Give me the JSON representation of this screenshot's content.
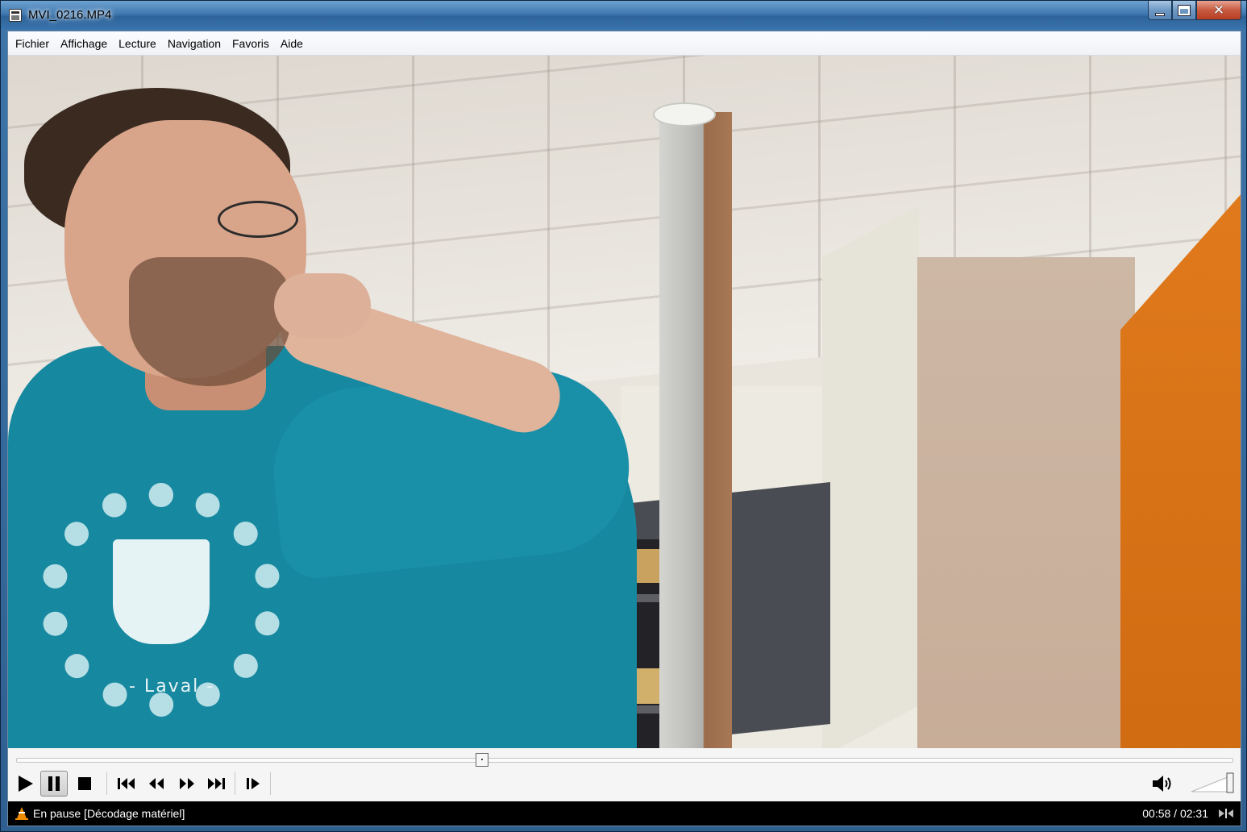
{
  "window": {
    "title": "MVI_0216.MP4",
    "caption_buttons": {
      "minimize": "minimize",
      "maximize": "maximize",
      "close": "✕"
    }
  },
  "menu": [
    {
      "label": "Fichier"
    },
    {
      "label": "Affichage"
    },
    {
      "label": "Lecture"
    },
    {
      "label": "Navigation"
    },
    {
      "label": "Favoris"
    },
    {
      "label": "Aide"
    }
  ],
  "video": {
    "hoodie_text": "- Laval -"
  },
  "seek": {
    "progress": 0.383
  },
  "controls": {
    "buttons": [
      "play-icon",
      "pause-icon",
      "stop-icon",
      "previous-icon",
      "rewind-icon",
      "fast-forward-icon",
      "next-icon",
      "frame-step-icon"
    ],
    "volume_icon": "speaker-icon",
    "volume_level": 1.0
  },
  "status": {
    "text": "En pause [Décodage matériel]",
    "time": "00:58 / 02:31",
    "icon": "vlc-cone-icon"
  },
  "colors": {
    "titlebar": "#3f78b0",
    "status_bg": "#000000",
    "accent_orange": "#e07a1c"
  }
}
